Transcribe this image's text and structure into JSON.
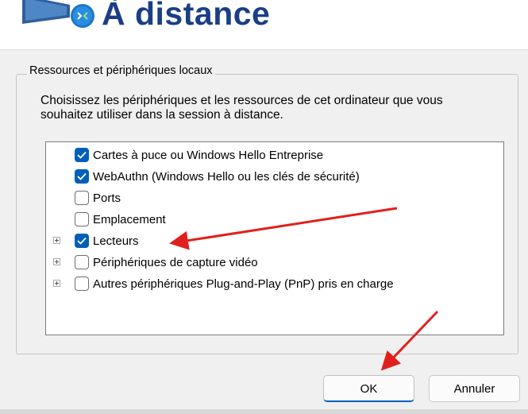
{
  "header": {
    "title": "À distance",
    "icon": "remote-desktop-icon"
  },
  "group": {
    "legend": "Ressources et périphériques locaux",
    "description": "Choisissez les périphériques et les ressources de cet ordinateur que vous souhaitez utiliser dans la session à distance."
  },
  "list": {
    "items": [
      {
        "label": "Cartes à puce ou Windows Hello Entreprise",
        "checked": true,
        "expandable": false
      },
      {
        "label": "WebAuthn (Windows Hello ou les clés de sécurité)",
        "checked": true,
        "expandable": false
      },
      {
        "label": "Ports",
        "checked": false,
        "expandable": false
      },
      {
        "label": "Emplacement",
        "checked": false,
        "expandable": false
      },
      {
        "label": "Lecteurs",
        "checked": true,
        "expandable": true
      },
      {
        "label": "Périphériques de capture vidéo",
        "checked": false,
        "expandable": true
      },
      {
        "label": "Autres périphériques Plug-and-Play (PnP) pris en charge",
        "checked": false,
        "expandable": true
      }
    ]
  },
  "buttons": {
    "ok_label": "OK",
    "cancel_label": "Annuler"
  },
  "colors": {
    "accent": "#005fb8",
    "title": "#1b3f86",
    "annotation_arrow": "#e0201c"
  }
}
